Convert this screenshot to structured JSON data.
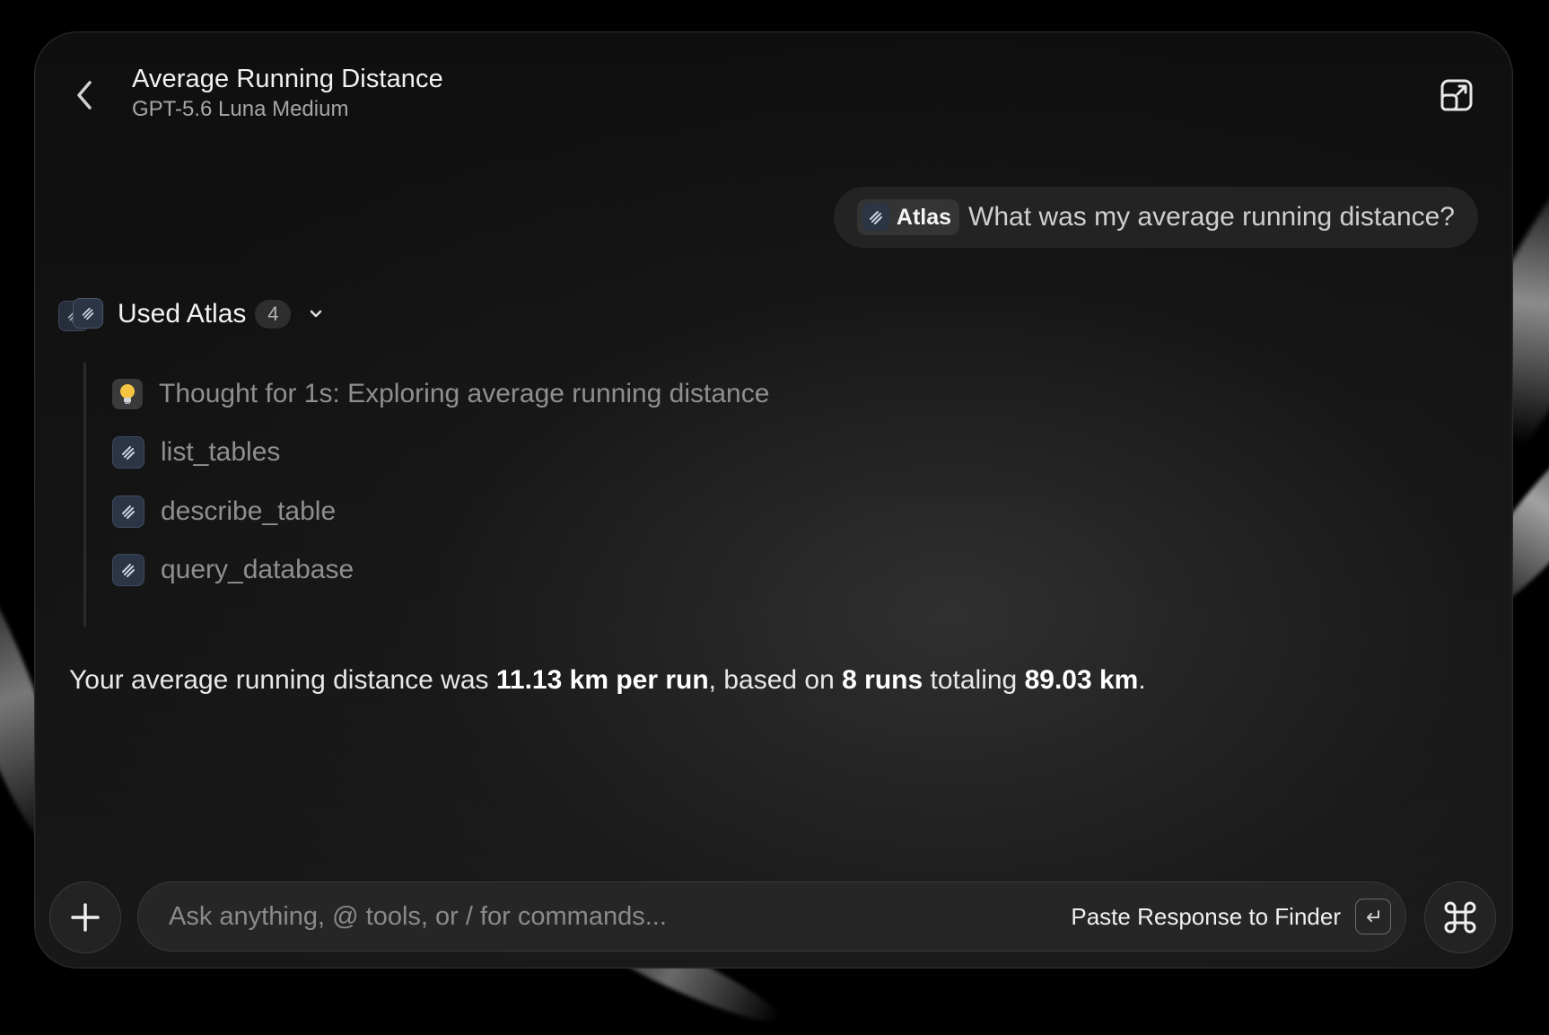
{
  "header": {
    "title": "Average Running Distance",
    "subtitle": "GPT-5.6 Luna Medium"
  },
  "user_message": {
    "chip_label": "Atlas",
    "text": "What was my average running distance?"
  },
  "tool_usage": {
    "label": "Used Atlas",
    "count": "4",
    "steps": [
      {
        "icon": "lightbulb-icon",
        "text": "Thought for 1s: Exploring average running distance"
      },
      {
        "icon": "atlas-icon",
        "text": "list_tables"
      },
      {
        "icon": "atlas-icon",
        "text": "describe_table"
      },
      {
        "icon": "atlas-icon",
        "text": "query_database"
      }
    ]
  },
  "answer": {
    "part1": "Your average running distance was ",
    "bold1": "11.13 km per run",
    "part2": ", based on ",
    "bold2": "8 runs",
    "part3": " totaling ",
    "bold3": "89.03 km",
    "part4": "."
  },
  "composer": {
    "placeholder": "Ask anything, @ tools, or / for commands...",
    "action_label": "Paste Response to Finder"
  },
  "colors": {
    "background": "#000000",
    "window": "#141414",
    "tool_icon_bg": "#2b3546",
    "muted_text": "#8f8f8f"
  }
}
